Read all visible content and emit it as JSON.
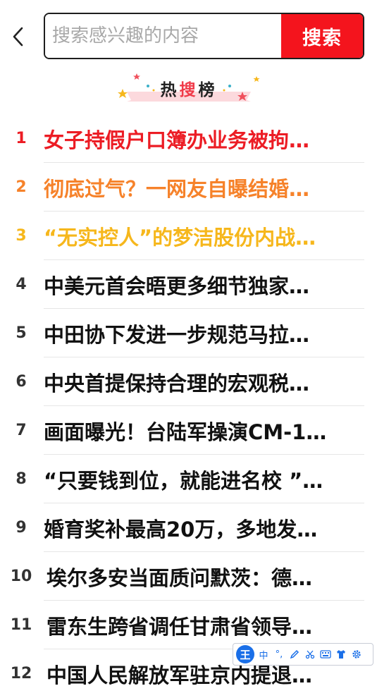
{
  "search": {
    "placeholder": "搜索感兴趣的内容",
    "button_label": "搜索"
  },
  "hot_section": {
    "title_part1": "热",
    "title_part2": "搜",
    "title_part3": "榜"
  },
  "hot_list": [
    {
      "rank": "1",
      "title": "女子持假户口簿办业务被拘…"
    },
    {
      "rank": "2",
      "title": "彻底过气？一网友自曝结婚…"
    },
    {
      "rank": "3",
      "title": "“无实控人”的梦洁股份内战…"
    },
    {
      "rank": "4",
      "title": "中美元首会晤更多细节独家…"
    },
    {
      "rank": "5",
      "title": "中田协下发进一步规范马拉…"
    },
    {
      "rank": "6",
      "title": "中央首提保持合理的宏观税…"
    },
    {
      "rank": "7",
      "title": "画面曝光！台陆军操演CM-1…"
    },
    {
      "rank": "8",
      "title": "“只要钱到位，就能进名校 ”…"
    },
    {
      "rank": "9",
      "title": "婚育奖补最高20万，多地发…"
    },
    {
      "rank": "10",
      "title": "埃尔多安当面质问默茨：德…"
    },
    {
      "rank": "11",
      "title": "雷东生跨省调任甘肃省领导…"
    },
    {
      "rank": "12",
      "title": "中国人民解放军驻京内提退…"
    }
  ],
  "ime_toolbar": {
    "logo": "王",
    "mode": "中",
    "punct": "°,"
  },
  "colors": {
    "accent_red": "#f4141d",
    "rank1": "#ec1c24",
    "rank2": "#f6822a",
    "rank3": "#f6b71c"
  }
}
